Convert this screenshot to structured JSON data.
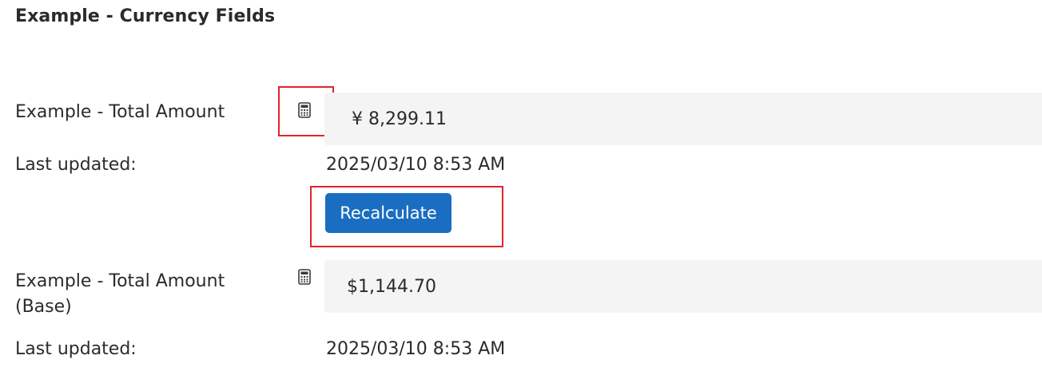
{
  "section": {
    "title": "Example - Currency Fields"
  },
  "fields": [
    {
      "label": "Example - Total Amount",
      "icon": "calculator-icon",
      "value": "¥ 8,299.11",
      "updated_label": "Last updated:",
      "updated_value": "2025/03/10 8:53 AM"
    },
    {
      "label": "Example - Total Amount (Base)",
      "icon": "calculator-icon",
      "value": "$1,144.70",
      "updated_label": "Last updated:",
      "updated_value": "2025/03/10 8:53 AM"
    }
  ],
  "actions": {
    "recalculate_label": "Recalculate"
  },
  "colors": {
    "button": "#1a6ec2",
    "highlight": "#e0242f",
    "field_background": "#f4f4f4"
  }
}
